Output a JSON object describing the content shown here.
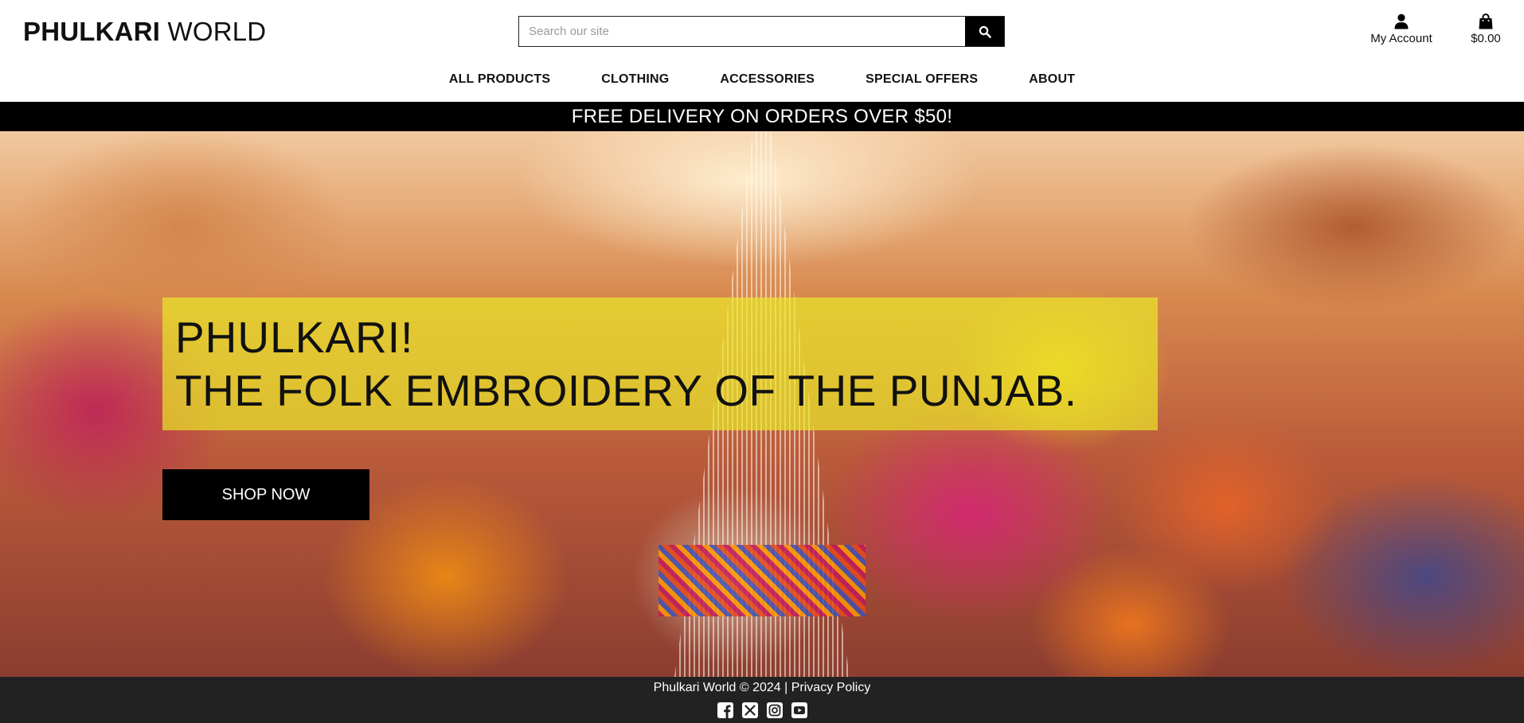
{
  "header": {
    "logo_bold": "PHULKARI",
    "logo_light": "WORLD",
    "search": {
      "placeholder": "Search our site"
    },
    "account_label": "My Account",
    "cart_label": "$0.00"
  },
  "nav": {
    "items": [
      "ALL PRODUCTS",
      "CLOTHING",
      "ACCESSORIES",
      "SPECIAL OFFERS",
      "ABOUT"
    ]
  },
  "banner": {
    "text": "FREE DELIVERY ON ORDERS OVER $50!"
  },
  "hero": {
    "title": "PHULKARI!",
    "subtitle": "THE FOLK EMBROIDERY OF THE PUNJAB.",
    "cta_label": "SHOP NOW"
  },
  "footer": {
    "copyright": "Phulkari World © 2024 |",
    "privacy_label": "Privacy Policy",
    "socials": [
      "facebook-icon",
      "x-icon",
      "instagram-icon",
      "youtube-icon"
    ]
  },
  "colors": {
    "banner_bg": "#000000",
    "hero_panel": "#EBEB28",
    "footer_bg": "#222222",
    "button_bg": "#000000"
  }
}
